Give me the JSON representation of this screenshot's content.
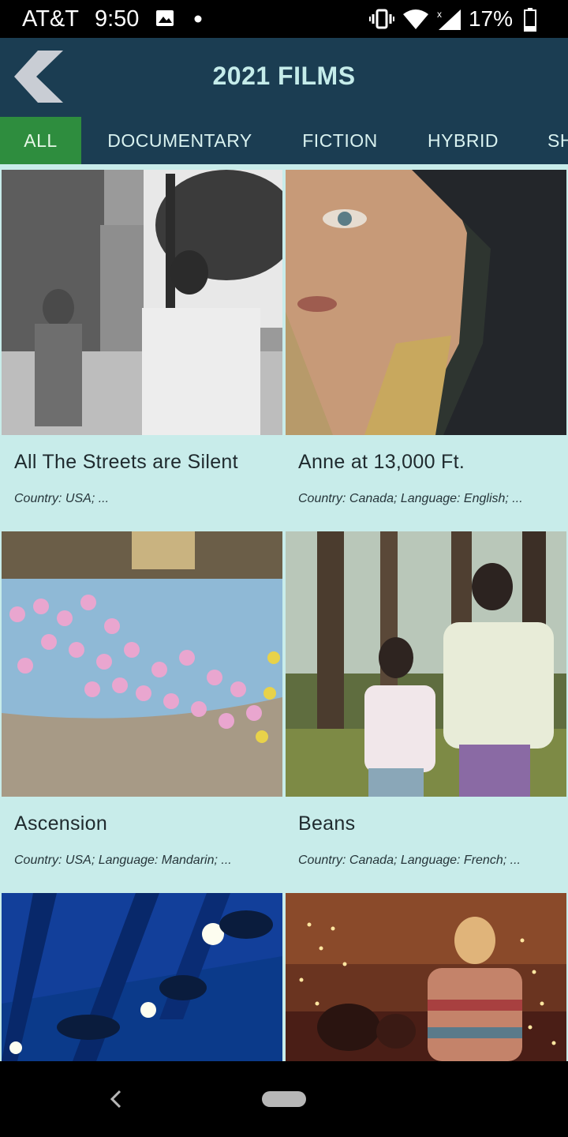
{
  "status": {
    "carrier": "AT&T",
    "time": "9:50",
    "battery": "17%",
    "icons": [
      "image-icon",
      "dot-icon",
      "vibrate-icon",
      "wifi-icon",
      "signal-icon",
      "battery-icon"
    ]
  },
  "header": {
    "title": "2021 FILMS",
    "back_icon": "chevron-left-icon"
  },
  "tabs": [
    {
      "label": "ALL",
      "active": true
    },
    {
      "label": "DOCUMENTARY",
      "active": false
    },
    {
      "label": "FICTION",
      "active": false
    },
    {
      "label": "HYBRID",
      "active": false
    },
    {
      "label": "SH",
      "active": false
    }
  ],
  "films": [
    {
      "title": "All The Streets are Silent",
      "meta": "Country: USA; ..."
    },
    {
      "title": "Anne at 13,000 Ft.",
      "meta": "Country: Canada; Language: English; ..."
    },
    {
      "title": "Ascension",
      "meta": "Country: USA; Language: Mandarin; ..."
    },
    {
      "title": "Beans",
      "meta": "Country: Canada; Language: French; ..."
    },
    {
      "title": "",
      "meta": ""
    },
    {
      "title": "",
      "meta": ""
    }
  ],
  "colors": {
    "header_bg": "#1b3d52",
    "active_tab": "#2e8d3e",
    "content_bg": "#c8ecea",
    "title_text": "#c5ecea"
  }
}
